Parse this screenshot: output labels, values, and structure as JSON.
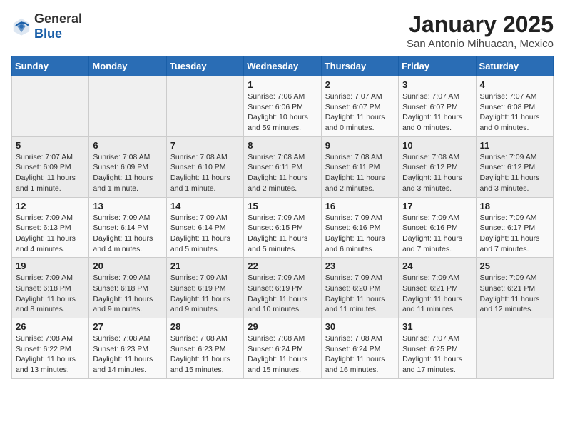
{
  "header": {
    "logo": {
      "general": "General",
      "blue": "Blue"
    },
    "title": "January 2025",
    "location": "San Antonio Mihuacan, Mexico"
  },
  "weekdays": [
    "Sunday",
    "Monday",
    "Tuesday",
    "Wednesday",
    "Thursday",
    "Friday",
    "Saturday"
  ],
  "weeks": [
    [
      {
        "day": "",
        "info": ""
      },
      {
        "day": "",
        "info": ""
      },
      {
        "day": "",
        "info": ""
      },
      {
        "day": "1",
        "info": "Sunrise: 7:06 AM\nSunset: 6:06 PM\nDaylight: 10 hours\nand 59 minutes."
      },
      {
        "day": "2",
        "info": "Sunrise: 7:07 AM\nSunset: 6:07 PM\nDaylight: 11 hours\nand 0 minutes."
      },
      {
        "day": "3",
        "info": "Sunrise: 7:07 AM\nSunset: 6:07 PM\nDaylight: 11 hours\nand 0 minutes."
      },
      {
        "day": "4",
        "info": "Sunrise: 7:07 AM\nSunset: 6:08 PM\nDaylight: 11 hours\nand 0 minutes."
      }
    ],
    [
      {
        "day": "5",
        "info": "Sunrise: 7:07 AM\nSunset: 6:09 PM\nDaylight: 11 hours\nand 1 minute."
      },
      {
        "day": "6",
        "info": "Sunrise: 7:08 AM\nSunset: 6:09 PM\nDaylight: 11 hours\nand 1 minute."
      },
      {
        "day": "7",
        "info": "Sunrise: 7:08 AM\nSunset: 6:10 PM\nDaylight: 11 hours\nand 1 minute."
      },
      {
        "day": "8",
        "info": "Sunrise: 7:08 AM\nSunset: 6:11 PM\nDaylight: 11 hours\nand 2 minutes."
      },
      {
        "day": "9",
        "info": "Sunrise: 7:08 AM\nSunset: 6:11 PM\nDaylight: 11 hours\nand 2 minutes."
      },
      {
        "day": "10",
        "info": "Sunrise: 7:08 AM\nSunset: 6:12 PM\nDaylight: 11 hours\nand 3 minutes."
      },
      {
        "day": "11",
        "info": "Sunrise: 7:09 AM\nSunset: 6:12 PM\nDaylight: 11 hours\nand 3 minutes."
      }
    ],
    [
      {
        "day": "12",
        "info": "Sunrise: 7:09 AM\nSunset: 6:13 PM\nDaylight: 11 hours\nand 4 minutes."
      },
      {
        "day": "13",
        "info": "Sunrise: 7:09 AM\nSunset: 6:14 PM\nDaylight: 11 hours\nand 4 minutes."
      },
      {
        "day": "14",
        "info": "Sunrise: 7:09 AM\nSunset: 6:14 PM\nDaylight: 11 hours\nand 5 minutes."
      },
      {
        "day": "15",
        "info": "Sunrise: 7:09 AM\nSunset: 6:15 PM\nDaylight: 11 hours\nand 5 minutes."
      },
      {
        "day": "16",
        "info": "Sunrise: 7:09 AM\nSunset: 6:16 PM\nDaylight: 11 hours\nand 6 minutes."
      },
      {
        "day": "17",
        "info": "Sunrise: 7:09 AM\nSunset: 6:16 PM\nDaylight: 11 hours\nand 7 minutes."
      },
      {
        "day": "18",
        "info": "Sunrise: 7:09 AM\nSunset: 6:17 PM\nDaylight: 11 hours\nand 7 minutes."
      }
    ],
    [
      {
        "day": "19",
        "info": "Sunrise: 7:09 AM\nSunset: 6:18 PM\nDaylight: 11 hours\nand 8 minutes."
      },
      {
        "day": "20",
        "info": "Sunrise: 7:09 AM\nSunset: 6:18 PM\nDaylight: 11 hours\nand 9 minutes."
      },
      {
        "day": "21",
        "info": "Sunrise: 7:09 AM\nSunset: 6:19 PM\nDaylight: 11 hours\nand 9 minutes."
      },
      {
        "day": "22",
        "info": "Sunrise: 7:09 AM\nSunset: 6:19 PM\nDaylight: 11 hours\nand 10 minutes."
      },
      {
        "day": "23",
        "info": "Sunrise: 7:09 AM\nSunset: 6:20 PM\nDaylight: 11 hours\nand 11 minutes."
      },
      {
        "day": "24",
        "info": "Sunrise: 7:09 AM\nSunset: 6:21 PM\nDaylight: 11 hours\nand 11 minutes."
      },
      {
        "day": "25",
        "info": "Sunrise: 7:09 AM\nSunset: 6:21 PM\nDaylight: 11 hours\nand 12 minutes."
      }
    ],
    [
      {
        "day": "26",
        "info": "Sunrise: 7:08 AM\nSunset: 6:22 PM\nDaylight: 11 hours\nand 13 minutes."
      },
      {
        "day": "27",
        "info": "Sunrise: 7:08 AM\nSunset: 6:23 PM\nDaylight: 11 hours\nand 14 minutes."
      },
      {
        "day": "28",
        "info": "Sunrise: 7:08 AM\nSunset: 6:23 PM\nDaylight: 11 hours\nand 15 minutes."
      },
      {
        "day": "29",
        "info": "Sunrise: 7:08 AM\nSunset: 6:24 PM\nDaylight: 11 hours\nand 15 minutes."
      },
      {
        "day": "30",
        "info": "Sunrise: 7:08 AM\nSunset: 6:24 PM\nDaylight: 11 hours\nand 16 minutes."
      },
      {
        "day": "31",
        "info": "Sunrise: 7:07 AM\nSunset: 6:25 PM\nDaylight: 11 hours\nand 17 minutes."
      },
      {
        "day": "",
        "info": ""
      }
    ]
  ]
}
